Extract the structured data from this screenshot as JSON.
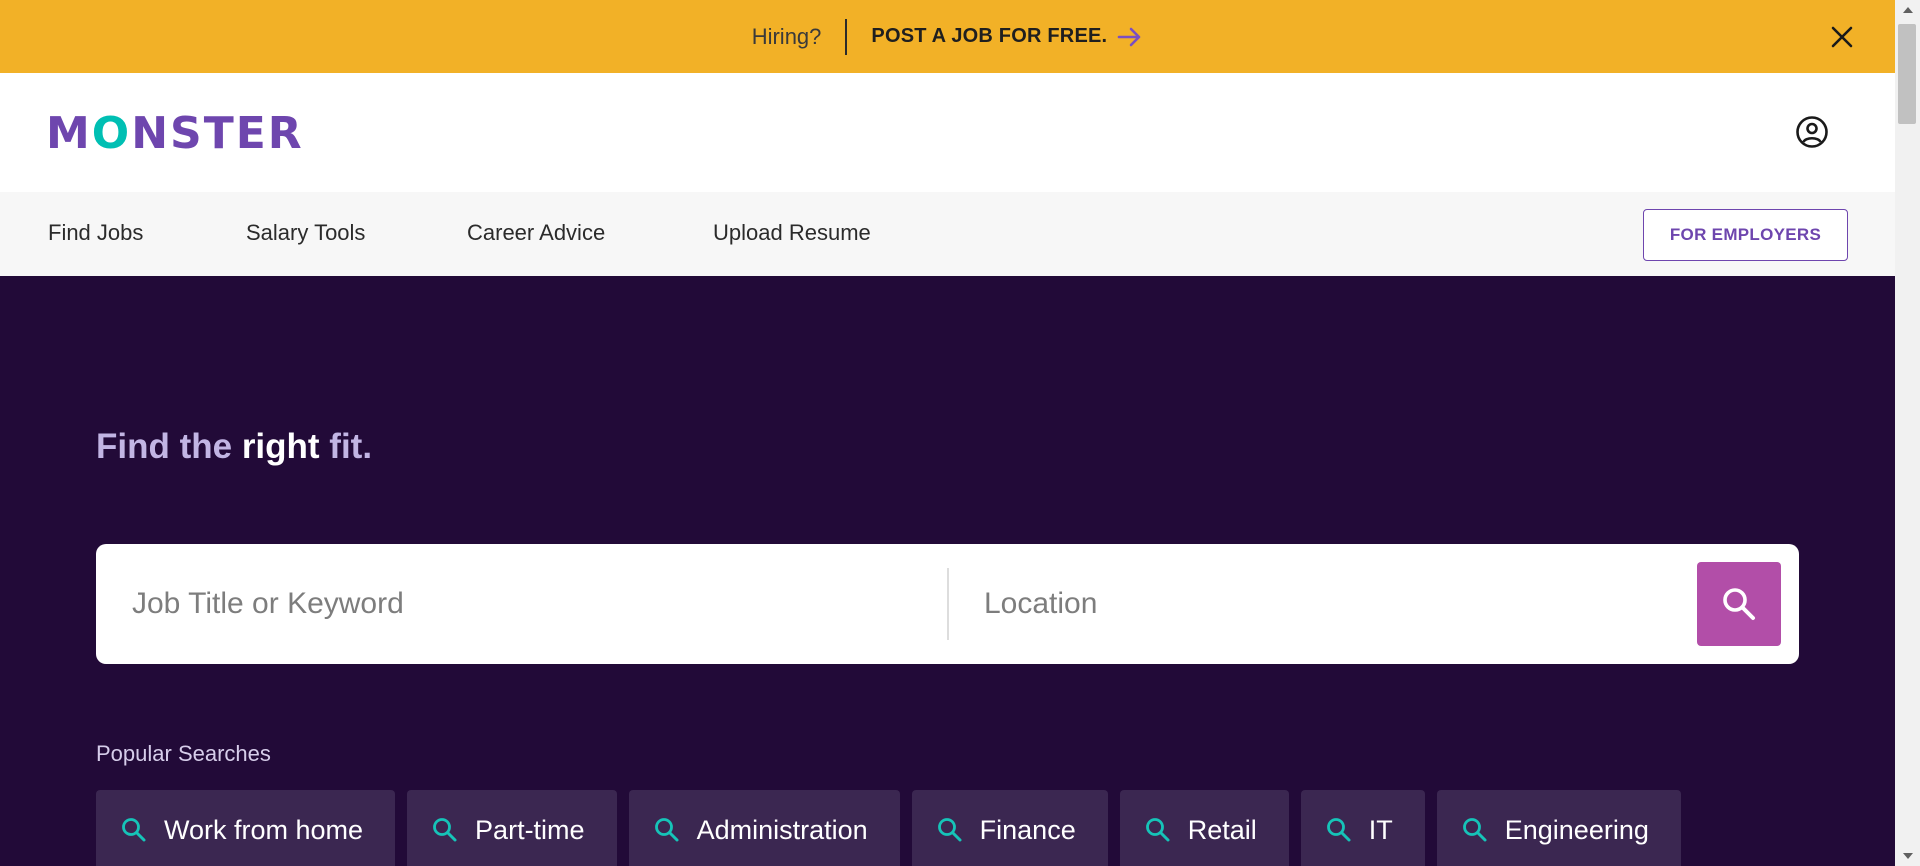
{
  "promo": {
    "hiring_text": "Hiring?",
    "cta_text": "POST A JOB FOR FREE.",
    "close_icon": "close-icon",
    "arrow_icon": "arrow-right-icon"
  },
  "header": {
    "logo": {
      "part1": "M",
      "o": "O",
      "part2": "NSTER"
    },
    "account_icon": "account-circle-icon"
  },
  "nav": {
    "items": [
      "Find Jobs",
      "Salary Tools",
      "Career Advice",
      "Upload Resume"
    ],
    "employers_label": "FOR EMPLOYERS"
  },
  "hero": {
    "title_prefix": "Find the ",
    "title_em": "right",
    "title_suffix": " fit.",
    "keyword_placeholder": "Job Title or Keyword",
    "keyword_value": "",
    "location_placeholder": "Location",
    "location_value": "",
    "search_icon": "search-icon"
  },
  "popular": {
    "label": "Popular Searches",
    "chips": [
      "Work from home",
      "Part-time",
      "Administration",
      "Finance",
      "Retail",
      "IT",
      "Engineering"
    ]
  },
  "colors": {
    "promo_bg": "#f2b127",
    "brand_purple": "#6e46ae",
    "brand_teal": "#00bfb3",
    "hero_bg": "#220a38",
    "search_button": "#b24ea8",
    "chip_bg": "#3b2751"
  }
}
